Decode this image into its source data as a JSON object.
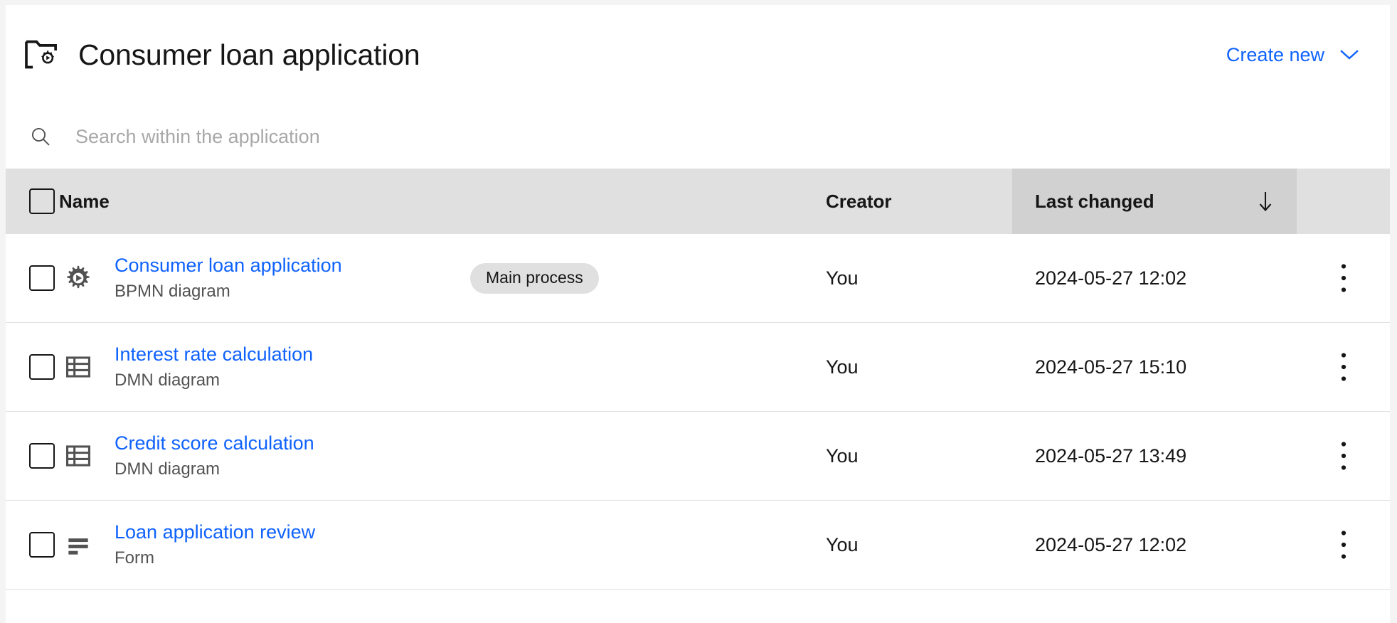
{
  "header": {
    "icon": "folder-process-icon",
    "title": "Consumer loan application",
    "create_new_label": "Create new",
    "create_new_chevron": "chevron-down-icon",
    "link_color": "#0f62fe"
  },
  "search": {
    "icon": "search-icon",
    "placeholder": "Search within the application",
    "value": ""
  },
  "table": {
    "columns": {
      "name": "Name",
      "creator": "Creator",
      "last_changed": "Last changed"
    },
    "sort": {
      "column": "Last changed",
      "direction": "descending",
      "icon": "arrow-down-icon",
      "header_highlight": "#d1d1d1"
    },
    "header_background": "#e0e0e0",
    "select_all": {
      "icon": "checkbox-unchecked-icon",
      "checked": false
    },
    "rows": [
      {
        "icon": "bpmn-process-icon",
        "name": "Consumer loan application",
        "type": "BPMN diagram",
        "tag": "Main process",
        "creator": "You",
        "last_changed": "2024-05-27 12:02",
        "menu_icon": "overflow-menu-icon",
        "checked": false
      },
      {
        "icon": "dmn-table-icon",
        "name": "Interest rate calculation",
        "type": "DMN diagram",
        "tag": "",
        "creator": "You",
        "last_changed": "2024-05-27 15:10",
        "menu_icon": "overflow-menu-icon",
        "checked": false
      },
      {
        "icon": "dmn-table-icon",
        "name": "Credit score calculation",
        "type": "DMN diagram",
        "tag": "",
        "creator": "You",
        "last_changed": "2024-05-27 13:49",
        "menu_icon": "overflow-menu-icon",
        "checked": false
      },
      {
        "icon": "form-icon",
        "name": "Loan application review",
        "type": "Form",
        "tag": "",
        "creator": "You",
        "last_changed": "2024-05-27 12:02",
        "menu_icon": "overflow-menu-icon",
        "checked": false
      }
    ]
  }
}
